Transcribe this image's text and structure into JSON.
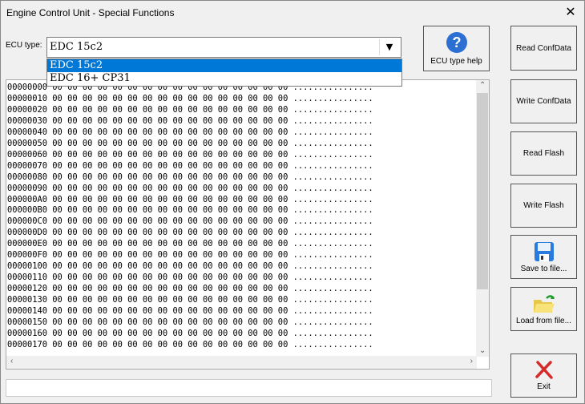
{
  "window": {
    "title": "Engine Control Unit - Special Functions",
    "close": "✕"
  },
  "ecu": {
    "label": "ECU type:",
    "selected": "EDC 15c2",
    "options": [
      "EDC 15c2",
      "EDC 16+ CP31"
    ]
  },
  "buttons": {
    "help": "ECU type help",
    "read_conf": "Read ConfData",
    "write_conf": "Write ConfData",
    "read_flash": "Read Flash",
    "write_flash": "Write Flash",
    "save": "Save to file...",
    "load": "Load from file...",
    "exit": "Exit"
  },
  "hex": {
    "addresses": [
      "00000000",
      "00000010",
      "00000020",
      "00000030",
      "00000040",
      "00000050",
      "00000060",
      "00000070",
      "00000080",
      "00000090",
      "000000A0",
      "000000B0",
      "000000C0",
      "000000D0",
      "000000E0",
      "000000F0",
      "00000100",
      "00000110",
      "00000120",
      "00000130",
      "00000140",
      "00000150",
      "00000160",
      "00000170"
    ],
    "byte": "00",
    "ascii": "................"
  },
  "status": ""
}
